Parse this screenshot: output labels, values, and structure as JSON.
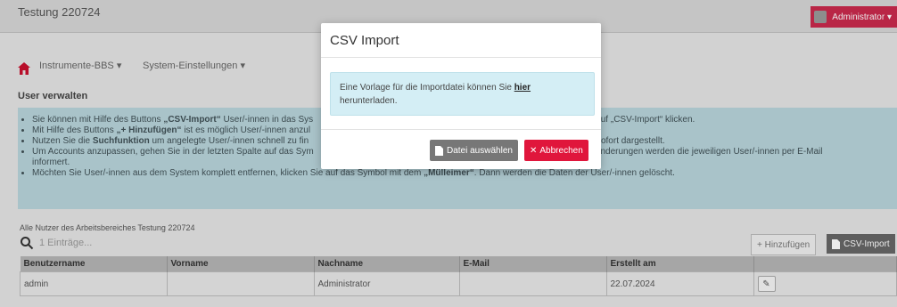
{
  "app": {
    "title": "Testung 220724",
    "user": "Administrator ▾"
  },
  "nav": {
    "item1": "Instrumente-BBS ▾",
    "item2": "System-Einstellungen ▾"
  },
  "section_title": "User verwalten",
  "info": {
    "line1_a": "Sie können mit Hilfe des Buttons ",
    "line1_b": "„CSV-Import“",
    "line1_c": " User/-innen in das Sys",
    "line1_tail": "f, wenn Sie auf „CSV-Import“ klicken.",
    "line2_a": "Mit Hilfe des Buttons ",
    "line2_b": "„+ Hinzufügen“",
    "line2_c": " ist es möglich User/-innen anzul",
    "line3_a": "Nutzen Sie die ",
    "line3_b": "Suchfunktion",
    "line3_c": " um angelegte User/-innen schnell zu fin",
    "line3_tail": "s Ergebnis sofort dargestellt.",
    "line4_a": "Um Accounts anzupassen, gehen Sie in der letzten Spalte auf das Sym",
    "line4_tail": ". Bei den Änderungen werden die jeweiligen User/-innen per E-Mail",
    "line4_b": "informert.",
    "line5_a": "Möchten Sie User/-innen aus dem System komplett entfernen, klicken Sie auf das Symbol mit dem ",
    "line5_b": "„Mülleimer“",
    "line5_c": ". Dann werden die Daten der User/-innen gelöscht."
  },
  "table_caption": "Alle Nutzer des Arbeitsbereiches Testung 220724",
  "search": {
    "placeholder": "1 Einträge..."
  },
  "buttons": {
    "add": "+ Hinzufügen",
    "csv": "CSV-Import"
  },
  "table": {
    "headers": [
      "Benutzername",
      "Vorname",
      "Nachname",
      "E-Mail",
      "Erstellt am",
      ""
    ],
    "rows": [
      {
        "user": "admin",
        "first": "",
        "last": "Administrator",
        "email": "",
        "created": "22.07.2024"
      }
    ]
  },
  "modal": {
    "title": "CSV Import",
    "text_before": "Eine Vorlage für die Importdatei können Sie ",
    "link": "hier",
    "text_after": "herunterladen.",
    "file_button": "Datei auswählen",
    "cancel_button": "Abbrechen"
  },
  "colors": {
    "accent": "#e0163c",
    "info_bg": "#b8d4db",
    "alert_bg": "#d4eef5"
  }
}
